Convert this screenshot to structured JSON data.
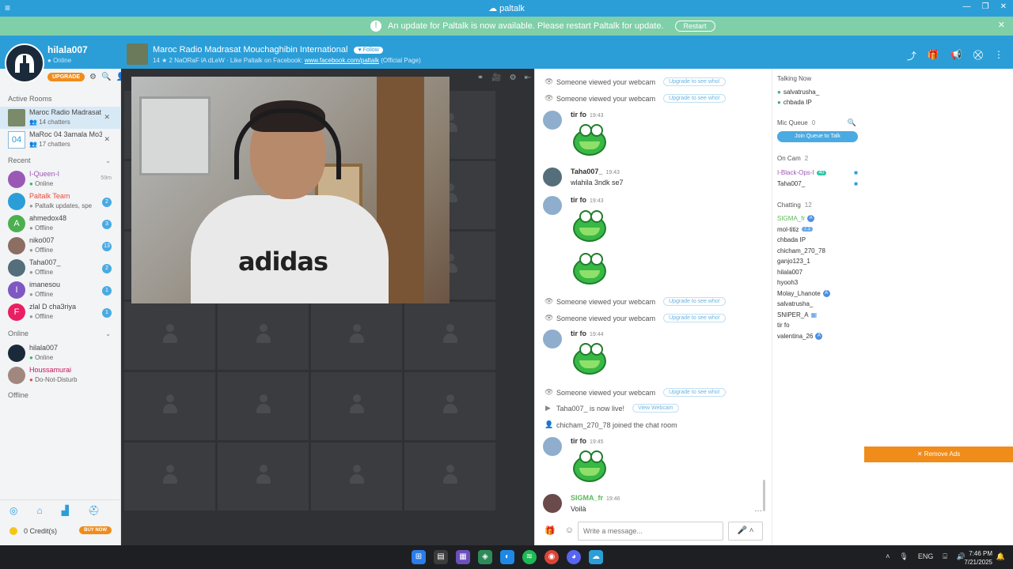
{
  "titlebar": {
    "menu_icon": "hamburger-icon",
    "brand": "paltalk"
  },
  "update_bar": {
    "message": "An update for Paltalk is now available. Please restart Paltalk for update.",
    "restart_label": "Restart"
  },
  "user": {
    "name": "hilala007",
    "status": "Online",
    "upgrade_label": "UPGRADE"
  },
  "room": {
    "title": "Maroc Radio Madrasat Mouchaghibin International",
    "follow_label": "Follow",
    "meta_counts": "14 ★ 2",
    "meta_text": "NaORaF lA dLeW · Like Paltalk on Facebook:",
    "meta_link": "www.facebook.com/paltalk",
    "meta_suffix": "(Official Page)"
  },
  "sidebar": {
    "active_rooms_label": "Active Rooms",
    "active_rooms": [
      {
        "name": "Maroc Radio Madrasat",
        "count": "14 chatters"
      },
      {
        "num": "04",
        "name": "MaRoc 04 3amala Mo3",
        "count": "17 chatters"
      }
    ],
    "recent_label": "Recent",
    "recent": [
      {
        "name": "I-Queen-I",
        "status": "Online",
        "time": "59m",
        "color": "#9b59b6",
        "initial": ""
      },
      {
        "name": "Paltalk Team",
        "status": "Paltalk updates, spe",
        "badge": "2",
        "color": "#2b9ed8",
        "initial": ""
      },
      {
        "name": "ahmedox48",
        "status": "Offline",
        "badge": "3",
        "color": "#4caf50",
        "initial": "A"
      },
      {
        "name": "niko007",
        "status": "Offline",
        "badge": "13",
        "color": "#8d6e63",
        "initial": ""
      },
      {
        "name": "Taha007_",
        "status": "Offline",
        "badge": "2",
        "color": "#546e7a",
        "initial": ""
      },
      {
        "name": "imanesou",
        "status": "Offline",
        "badge": "1",
        "color": "#7e57c2",
        "initial": "I"
      },
      {
        "name": "zlal D cha3riya",
        "status": "Offline",
        "badge": "1",
        "color": "#e91e63",
        "initial": "F"
      }
    ],
    "online_label": "Online",
    "online": [
      {
        "name": "hilala007",
        "status": "Online",
        "color": "#1a2a3a"
      },
      {
        "name": "Houssamurai",
        "status": "Do-Not-Disturb",
        "color": "#a1887f"
      }
    ],
    "offline_label": "Offline",
    "credits": "0 Credit(s)",
    "buy_label": "BUY NOW"
  },
  "chat": {
    "items": [
      {
        "kind": "sys",
        "icon": "👁",
        "text": "Someone viewed your webcam",
        "pill": "Upgrade to see who!"
      },
      {
        "kind": "sys",
        "icon": "👁",
        "text": "Someone viewed your webcam",
        "pill": "Upgrade to see who!"
      },
      {
        "kind": "msg",
        "name": "tir fo",
        "time": "19:43"
      },
      {
        "kind": "msg",
        "name": "Taha007_",
        "time": "19:43",
        "text": "wlahila 3ndk se7"
      },
      {
        "kind": "msg",
        "name": "tir fo",
        "time": "19:43"
      },
      {
        "kind": "sys",
        "icon": "👁",
        "text": "Someone viewed your webcam",
        "pill": "Upgrade to see who!"
      },
      {
        "kind": "sys",
        "icon": "👁",
        "text": "Someone viewed your webcam",
        "pill": "Upgrade to see who!"
      },
      {
        "kind": "msg",
        "name": "tir fo",
        "time": "19:44"
      },
      {
        "kind": "sys",
        "icon": "👁",
        "text": "Someone viewed your webcam",
        "pill": "Upgrade to see who!"
      },
      {
        "kind": "sys",
        "icon": "▶",
        "text": "Taha007_ is now live!",
        "pill": "View Webcam"
      },
      {
        "kind": "sys",
        "icon": "👤",
        "text": "chicham_270_78 joined the chat room"
      },
      {
        "kind": "msg",
        "name": "tir fo",
        "time": "19:45"
      },
      {
        "kind": "msg",
        "name": "SIGMA_fr",
        "time": "19:46",
        "text": "Voilà"
      }
    ],
    "placeholder": "Write a message..."
  },
  "users": {
    "talking_label": "Talking Now",
    "talking": [
      "salvatrusha_",
      "chbada IP"
    ],
    "mic_queue_label": "Mic Queue",
    "mic_queue_count": "0",
    "join_queue_label": "Join Queue to Talk",
    "on_cam_label": "On Cam",
    "on_cam_count": "2",
    "on_cam": [
      {
        "name": "I-Black-Ops-I",
        "level": "40"
      },
      {
        "name": "Taha007_"
      }
    ],
    "chatting_label": "Chatting",
    "chatting_count": "12",
    "chatting": [
      {
        "name": "SIGMA_fr",
        "badge": "A"
      },
      {
        "name": "mol-titiz",
        "lvl": "7.1"
      },
      {
        "name": "chbada IP"
      },
      {
        "name": "chicham_270_78"
      },
      {
        "name": "ganjo123_1"
      },
      {
        "name": "hilala007"
      },
      {
        "name": "hyooh3"
      },
      {
        "name": "Molay_Lhanote",
        "badge": "A"
      },
      {
        "name": "salvatrusha_"
      },
      {
        "name": "SNIPER_A",
        "grid": "▦"
      },
      {
        "name": "tir fo"
      },
      {
        "name": "valentina_26",
        "badge": "A"
      }
    ]
  },
  "ads": {
    "remove_label": "✕ Remove Ads"
  },
  "taskbar": {
    "lang": "ENG",
    "time": "7:46 PM",
    "date": "7/21/2025"
  },
  "colors": {
    "brand": "#2b9ed8",
    "update": "#7fcfa9",
    "accent": "#f08c1a"
  }
}
